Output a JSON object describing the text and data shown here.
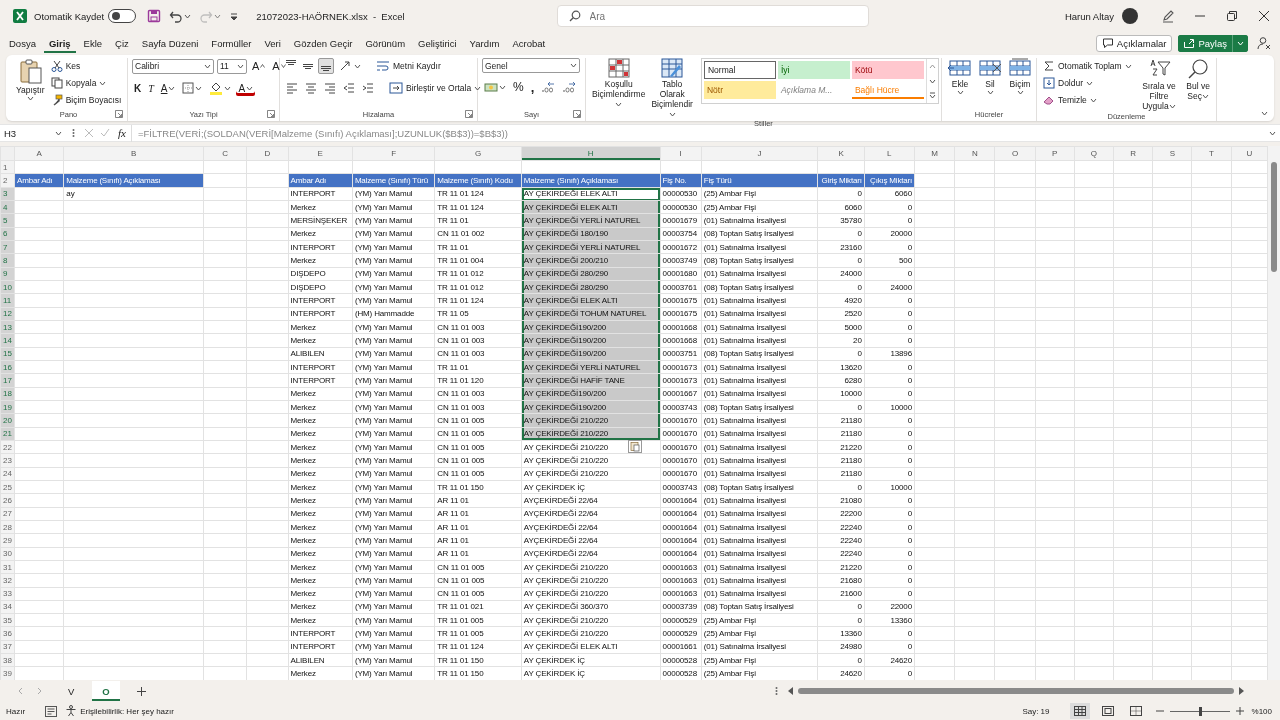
{
  "title_bar": {
    "autosave_label": "Otomatik Kaydet",
    "autosave_on": false,
    "title": "21072023-HAÖRNEK.xlsx  -  Excel",
    "search": {
      "placeholder": "Ara"
    },
    "user": "Harun Altay"
  },
  "menu": {
    "tabs": [
      {
        "label": "Dosya",
        "selected": false
      },
      {
        "label": "Giriş",
        "selected": true
      },
      {
        "label": "Ekle",
        "selected": false
      },
      {
        "label": "Çiz",
        "selected": false
      },
      {
        "label": "Sayfa Düzeni",
        "selected": false
      },
      {
        "label": "Formüller",
        "selected": false
      },
      {
        "label": "Veri",
        "selected": false
      },
      {
        "label": "Gözden Geçir",
        "selected": false
      },
      {
        "label": "Görünüm",
        "selected": false
      },
      {
        "label": "Geliştirici",
        "selected": false
      },
      {
        "label": "Yardım",
        "selected": false
      },
      {
        "label": "Acrobat",
        "selected": false
      }
    ],
    "comments_button": "Açıklamalar",
    "share_button": "Paylaş"
  },
  "ribbon": {
    "clipboard": {
      "label": "Pano",
      "paste": "Yapıştır",
      "cut": "Kes",
      "copy": "Kopyala",
      "format_painter": "Biçim Boyacısı"
    },
    "font": {
      "label": "Yazı Tipi",
      "family": "Calibri",
      "size": "11",
      "grow": "A",
      "shrink": "A",
      "bold": "K",
      "italic": "T",
      "underline": "A",
      "font_color": "A"
    },
    "alignment": {
      "label": "Hizalama",
      "vertical_align": [
        {
          "selected": false
        },
        {
          "selected": false
        },
        {
          "selected": true
        }
      ],
      "wrap": "Metni Kaydır",
      "merge": "Birleştir ve Ortala"
    },
    "number": {
      "label": "Sayı",
      "format": "Genel",
      "percent": "%",
      "comma": ","
    },
    "styles": {
      "label": "Stiller",
      "conditional": "Koşullu Biçimlendirme",
      "table": "Tablo Olarak Biçimlendir",
      "gallery": [
        {
          "label": "Normal",
          "kind": "normal"
        },
        {
          "label": "İyi",
          "kind": "good"
        },
        {
          "label": "Kötü",
          "kind": "bad"
        },
        {
          "label": "Nötr",
          "kind": "neutral"
        },
        {
          "label": "Açıklama M...",
          "kind": "explanatory"
        },
        {
          "label": "Bağlı Hücre",
          "kind": "linked"
        }
      ]
    },
    "cells": {
      "label": "Hücreler",
      "insert": "Ekle",
      "delete": "Sil",
      "format": "Biçim"
    },
    "editing": {
      "label": "Düzenleme",
      "autosum": "Otomatik Toplam",
      "fill": "Doldur",
      "clear": "Temizle",
      "sort": "Sırala ve Filtre Uygula",
      "find": "Bul ve Seç"
    }
  },
  "formula_bar": {
    "name_box": "H3",
    "fx": "fx",
    "formula": "=FİLTRE(VERİ;(SOLDAN(VERİ[Malzeme (Sınıfı) Açıklaması];UZUNLUK($B$3))=$B$3))"
  },
  "sheet": {
    "columns": [
      {
        "letter": "A",
        "selected": false
      },
      {
        "letter": "B",
        "selected": false
      },
      {
        "letter": "C",
        "selected": false
      },
      {
        "letter": "D",
        "selected": false
      },
      {
        "letter": "E",
        "selected": false
      },
      {
        "letter": "F",
        "selected": false
      },
      {
        "letter": "G",
        "selected": false
      },
      {
        "letter": "H",
        "selected": true
      },
      {
        "letter": "I",
        "selected": false
      },
      {
        "letter": "J",
        "selected": false
      },
      {
        "letter": "K",
        "selected": false
      },
      {
        "letter": "L",
        "selected": false
      },
      {
        "letter": "M",
        "selected": false
      },
      {
        "letter": "N",
        "selected": false
      },
      {
        "letter": "O",
        "selected": false
      },
      {
        "letter": "P",
        "selected": false
      },
      {
        "letter": "Q",
        "selected": false
      },
      {
        "letter": "R",
        "selected": false
      },
      {
        "letter": "S",
        "selected": false
      },
      {
        "letter": "T",
        "selected": false
      },
      {
        "letter": "U",
        "selected": false
      }
    ],
    "row_numbers": [
      "1",
      "2",
      "3",
      "4",
      "5",
      "6",
      "7",
      "8",
      "9",
      "10",
      "11",
      "12",
      "13",
      "14",
      "15",
      "16",
      "17",
      "18",
      "19",
      "20",
      "21",
      "22",
      "23",
      "24",
      "25",
      "26",
      "27",
      "28",
      "29",
      "30",
      "31",
      "32",
      "33",
      "34",
      "35",
      "36",
      "37",
      "38",
      "39"
    ],
    "criteria": {
      "headers": [
        "Ambar Adı",
        "Malzeme (Sınıfı) Açıklaması"
      ],
      "value": "ay"
    },
    "table": {
      "columns": [
        {
          "label": "Ambar Adı",
          "numeric": false
        },
        {
          "label": "Malzeme (Sınıfı) Türü",
          "numeric": false
        },
        {
          "label": "Malzeme (Sınıfı) Kodu",
          "numeric": false
        },
        {
          "label": "Malzeme (Sınıfı) Açıklaması",
          "numeric": false
        },
        {
          "label": "Fiş No.",
          "numeric": false
        },
        {
          "label": "Fiş Türü",
          "numeric": false
        },
        {
          "label": "Giriş Miktarı",
          "numeric": true
        },
        {
          "label": "Çıkış Miktarı",
          "numeric": true
        }
      ],
      "rows": [
        {
          "cells": [
            "INTERPORT",
            "(YM) Yarı Mamul",
            "TR 11 01 124",
            "AY ÇEKİRDEĞİ ELEK ALTI",
            "00000530",
            "(25) Ambar Fişi",
            "0",
            "6060"
          ],
          "selected": true,
          "active": true
        },
        {
          "cells": [
            "Merkez",
            "(YM) Yarı Mamul",
            "TR 11 01 124",
            "AY ÇEKİRDEĞİ ELEK ALTI",
            "00000530",
            "(25) Ambar Fişi",
            "6060",
            "0"
          ],
          "selected": true,
          "active": false
        },
        {
          "cells": [
            "MERSİNŞEKER",
            "(YM) Yarı Mamul",
            "TR 11 01",
            "AY ÇEKİRDEĞİ YERLİ NATUREL",
            "00001679",
            "(01) Satınalma İrsaliyesi",
            "35780",
            "0"
          ],
          "selected": true,
          "active": false
        },
        {
          "cells": [
            "Merkez",
            "(YM) Yarı Mamul",
            "CN 11 01 002",
            "AY ÇEKİRDEĞİ 180/190",
            "00003754",
            "(08) Toptan Satış İrsaliyesi",
            "0",
            "20000"
          ],
          "selected": true,
          "active": false
        },
        {
          "cells": [
            "INTERPORT",
            "(YM) Yarı Mamul",
            "TR 11 01",
            "AY ÇEKİRDEĞİ YERLİ NATUREL",
            "00001672",
            "(01) Satınalma İrsaliyesi",
            "23160",
            "0"
          ],
          "selected": true,
          "active": false
        },
        {
          "cells": [
            "Merkez",
            "(YM) Yarı Mamul",
            "TR 11 01 004",
            "AY ÇEKİRDEĞİ 200/210",
            "00003749",
            "(08) Toptan Satış İrsaliyesi",
            "0",
            "500"
          ],
          "selected": true,
          "active": false
        },
        {
          "cells": [
            "DIŞDEPO",
            "(YM) Yarı Mamul",
            "TR 11 01 012",
            "AY ÇEKİRDEĞİ 280/290",
            "00001680",
            "(01) Satınalma İrsaliyesi",
            "24000",
            "0"
          ],
          "selected": true,
          "active": false
        },
        {
          "cells": [
            "DIŞDEPO",
            "(YM) Yarı Mamul",
            "TR 11 01 012",
            "AY ÇEKİRDEĞİ 280/290",
            "00003761",
            "(08) Toptan Satış İrsaliyesi",
            "0",
            "24000"
          ],
          "selected": true,
          "active": false
        },
        {
          "cells": [
            "INTERPORT",
            "(YM) Yarı Mamul",
            "TR 11 01 124",
            "AY ÇEKİRDEĞİ ELEK ALTI",
            "00001675",
            "(01) Satınalma İrsaliyesi",
            "4920",
            "0"
          ],
          "selected": true,
          "active": false
        },
        {
          "cells": [
            "INTERPORT",
            "(HM) Hammadde",
            "TR 11 05",
            "AY ÇEKİRDEĞİ TOHUM NATUREL",
            "00001675",
            "(01) Satınalma İrsaliyesi",
            "2520",
            "0"
          ],
          "selected": true,
          "active": false
        },
        {
          "cells": [
            "Merkez",
            "(YM) Yarı Mamul",
            "CN 11 01 003",
            "AY ÇEKİRDEĞİ190/200",
            "00001668",
            "(01) Satınalma İrsaliyesi",
            "5000",
            "0"
          ],
          "selected": true,
          "active": false
        },
        {
          "cells": [
            "Merkez",
            "(YM) Yarı Mamul",
            "CN 11 01 003",
            "AY ÇEKİRDEĞİ190/200",
            "00001668",
            "(01) Satınalma İrsaliyesi",
            "20",
            "0"
          ],
          "selected": true,
          "active": false
        },
        {
          "cells": [
            "ALIBILEN",
            "(YM) Yarı Mamul",
            "CN 11 01 003",
            "AY ÇEKİRDEĞİ190/200",
            "00003751",
            "(08) Toptan Satış İrsaliyesi",
            "0",
            "13896"
          ],
          "selected": true,
          "active": false
        },
        {
          "cells": [
            "INTERPORT",
            "(YM) Yarı Mamul",
            "TR 11 01",
            "AY ÇEKİRDEĞİ YERLİ NATUREL",
            "00001673",
            "(01) Satınalma İrsaliyesi",
            "13620",
            "0"
          ],
          "selected": true,
          "active": false
        },
        {
          "cells": [
            "INTERPORT",
            "(YM) Yarı Mamul",
            "TR 11 01 120",
            "AY ÇEKİRDEĞİ HAFİF TANE",
            "00001673",
            "(01) Satınalma İrsaliyesi",
            "6280",
            "0"
          ],
          "selected": true,
          "active": false
        },
        {
          "cells": [
            "Merkez",
            "(YM) Yarı Mamul",
            "CN 11 01 003",
            "AY ÇEKİRDEĞİ190/200",
            "00001667",
            "(01) Satınalma İrsaliyesi",
            "10000",
            "0"
          ],
          "selected": true,
          "active": false
        },
        {
          "cells": [
            "Merkez",
            "(YM) Yarı Mamul",
            "CN 11 01 003",
            "AY ÇEKİRDEĞİ190/200",
            "00003743",
            "(08) Toptan Satış İrsaliyesi",
            "0",
            "10000"
          ],
          "selected": true,
          "active": false
        },
        {
          "cells": [
            "Merkez",
            "(YM) Yarı Mamul",
            "CN 11 01 005",
            "AY ÇEKİRDEĞİ 210/220",
            "00001670",
            "(01) Satınalma İrsaliyesi",
            "21180",
            "0"
          ],
          "selected": true,
          "active": false
        },
        {
          "cells": [
            "Merkez",
            "(YM) Yarı Mamul",
            "CN 11 01 005",
            "AY ÇEKİRDEĞİ 210/220",
            "00001670",
            "(01) Satınalma İrsaliyesi",
            "21180",
            "0"
          ],
          "selected": true,
          "active": false
        },
        {
          "cells": [
            "Merkez",
            "(YM) Yarı Mamul",
            "CN 11 01 005",
            "AY ÇEKİRDEĞİ 210/220",
            "00001670",
            "(01) Satınalma İrsaliyesi",
            "21220",
            "0"
          ],
          "selected": false,
          "active": false
        },
        {
          "cells": [
            "Merkez",
            "(YM) Yarı Mamul",
            "CN 11 01 005",
            "AY ÇEKİRDEĞİ 210/220",
            "00001670",
            "(01) Satınalma İrsaliyesi",
            "21180",
            "0"
          ],
          "selected": false,
          "active": false
        },
        {
          "cells": [
            "Merkez",
            "(YM) Yarı Mamul",
            "CN 11 01 005",
            "AY ÇEKİRDEĞİ 210/220",
            "00001670",
            "(01) Satınalma İrsaliyesi",
            "21180",
            "0"
          ],
          "selected": false,
          "active": false
        },
        {
          "cells": [
            "Merkez",
            "(YM) Yarı Mamul",
            "TR 11 01 150",
            "AY ÇEKİRDEK İÇ",
            "00003743",
            "(08) Toptan Satış İrsaliyesi",
            "0",
            "10000"
          ],
          "selected": false,
          "active": false
        },
        {
          "cells": [
            "Merkez",
            "(YM) Yarı Mamul",
            "AR 11 01",
            "AYÇEKİRDEĞİ 22/64",
            "00001664",
            "(01) Satınalma İrsaliyesi",
            "21080",
            "0"
          ],
          "selected": false,
          "active": false
        },
        {
          "cells": [
            "Merkez",
            "(YM) Yarı Mamul",
            "AR 11 01",
            "AYÇEKİRDEĞİ 22/64",
            "00001664",
            "(01) Satınalma İrsaliyesi",
            "22200",
            "0"
          ],
          "selected": false,
          "active": false
        },
        {
          "cells": [
            "Merkez",
            "(YM) Yarı Mamul",
            "AR 11 01",
            "AYÇEKİRDEĞİ 22/64",
            "00001664",
            "(01) Satınalma İrsaliyesi",
            "22240",
            "0"
          ],
          "selected": false,
          "active": false
        },
        {
          "cells": [
            "Merkez",
            "(YM) Yarı Mamul",
            "AR 11 01",
            "AYÇEKİRDEĞİ 22/64",
            "00001664",
            "(01) Satınalma İrsaliyesi",
            "22240",
            "0"
          ],
          "selected": false,
          "active": false
        },
        {
          "cells": [
            "Merkez",
            "(YM) Yarı Mamul",
            "AR 11 01",
            "AYÇEKİRDEĞİ 22/64",
            "00001664",
            "(01) Satınalma İrsaliyesi",
            "22240",
            "0"
          ],
          "selected": false,
          "active": false
        },
        {
          "cells": [
            "Merkez",
            "(YM) Yarı Mamul",
            "CN 11 01 005",
            "AY ÇEKİRDEĞİ 210/220",
            "00001663",
            "(01) Satınalma İrsaliyesi",
            "21220",
            "0"
          ],
          "selected": false,
          "active": false
        },
        {
          "cells": [
            "Merkez",
            "(YM) Yarı Mamul",
            "CN 11 01 005",
            "AY ÇEKİRDEĞİ 210/220",
            "00001663",
            "(01) Satınalma İrsaliyesi",
            "21680",
            "0"
          ],
          "selected": false,
          "active": false
        },
        {
          "cells": [
            "Merkez",
            "(YM) Yarı Mamul",
            "CN 11 01 005",
            "AY ÇEKİRDEĞİ 210/220",
            "00001663",
            "(01) Satınalma İrsaliyesi",
            "21600",
            "0"
          ],
          "selected": false,
          "active": false
        },
        {
          "cells": [
            "Merkez",
            "(YM) Yarı Mamul",
            "TR 11 01 021",
            "AY ÇEKİRDEĞİ 360/370",
            "00003739",
            "(08) Toptan Satış İrsaliyesi",
            "0",
            "22000"
          ],
          "selected": false,
          "active": false
        },
        {
          "cells": [
            "Merkez",
            "(YM) Yarı Mamul",
            "TR 11 01 005",
            "AY ÇEKİRDEĞİ 210/220",
            "00000529",
            "(25) Ambar Fişi",
            "0",
            "13360"
          ],
          "selected": false,
          "active": false
        },
        {
          "cells": [
            "INTERPORT",
            "(YM) Yarı Mamul",
            "TR 11 01 005",
            "AY ÇEKİRDEĞİ 210/220",
            "00000529",
            "(25) Ambar Fişi",
            "13360",
            "0"
          ],
          "selected": false,
          "active": false
        },
        {
          "cells": [
            "INTERPORT",
            "(YM) Yarı Mamul",
            "TR 11 01 124",
            "AY ÇEKİRDEĞİ ELEK ALTI",
            "00001661",
            "(01) Satınalma İrsaliyesi",
            "24980",
            "0"
          ],
          "selected": false,
          "active": false
        },
        {
          "cells": [
            "ALIBILEN",
            "(YM) Yarı Mamul",
            "TR 11 01 150",
            "AY ÇEKİRDEK İÇ",
            "00000528",
            "(25) Ambar Fişi",
            "0",
            "24620"
          ],
          "selected": false,
          "active": false
        },
        {
          "cells": [
            "Merkez",
            "(YM) Yarı Mamul",
            "TR 11 01 150",
            "AY ÇEKİRDEK İÇ",
            "00000528",
            "(25) Ambar Fişi",
            "24620",
            "0"
          ],
          "selected": false,
          "active": false
        }
      ]
    }
  },
  "sheet_tabs": [
    {
      "label": "V",
      "selected": false
    },
    {
      "label": "O",
      "selected": true
    }
  ],
  "status_bar": {
    "ready": "Hazır",
    "accessibility": "Erişilebilirlik: Her şey hazır",
    "count": "Say: 19",
    "zoom": {
      "level": 0.5,
      "reading": "%100"
    }
  }
}
